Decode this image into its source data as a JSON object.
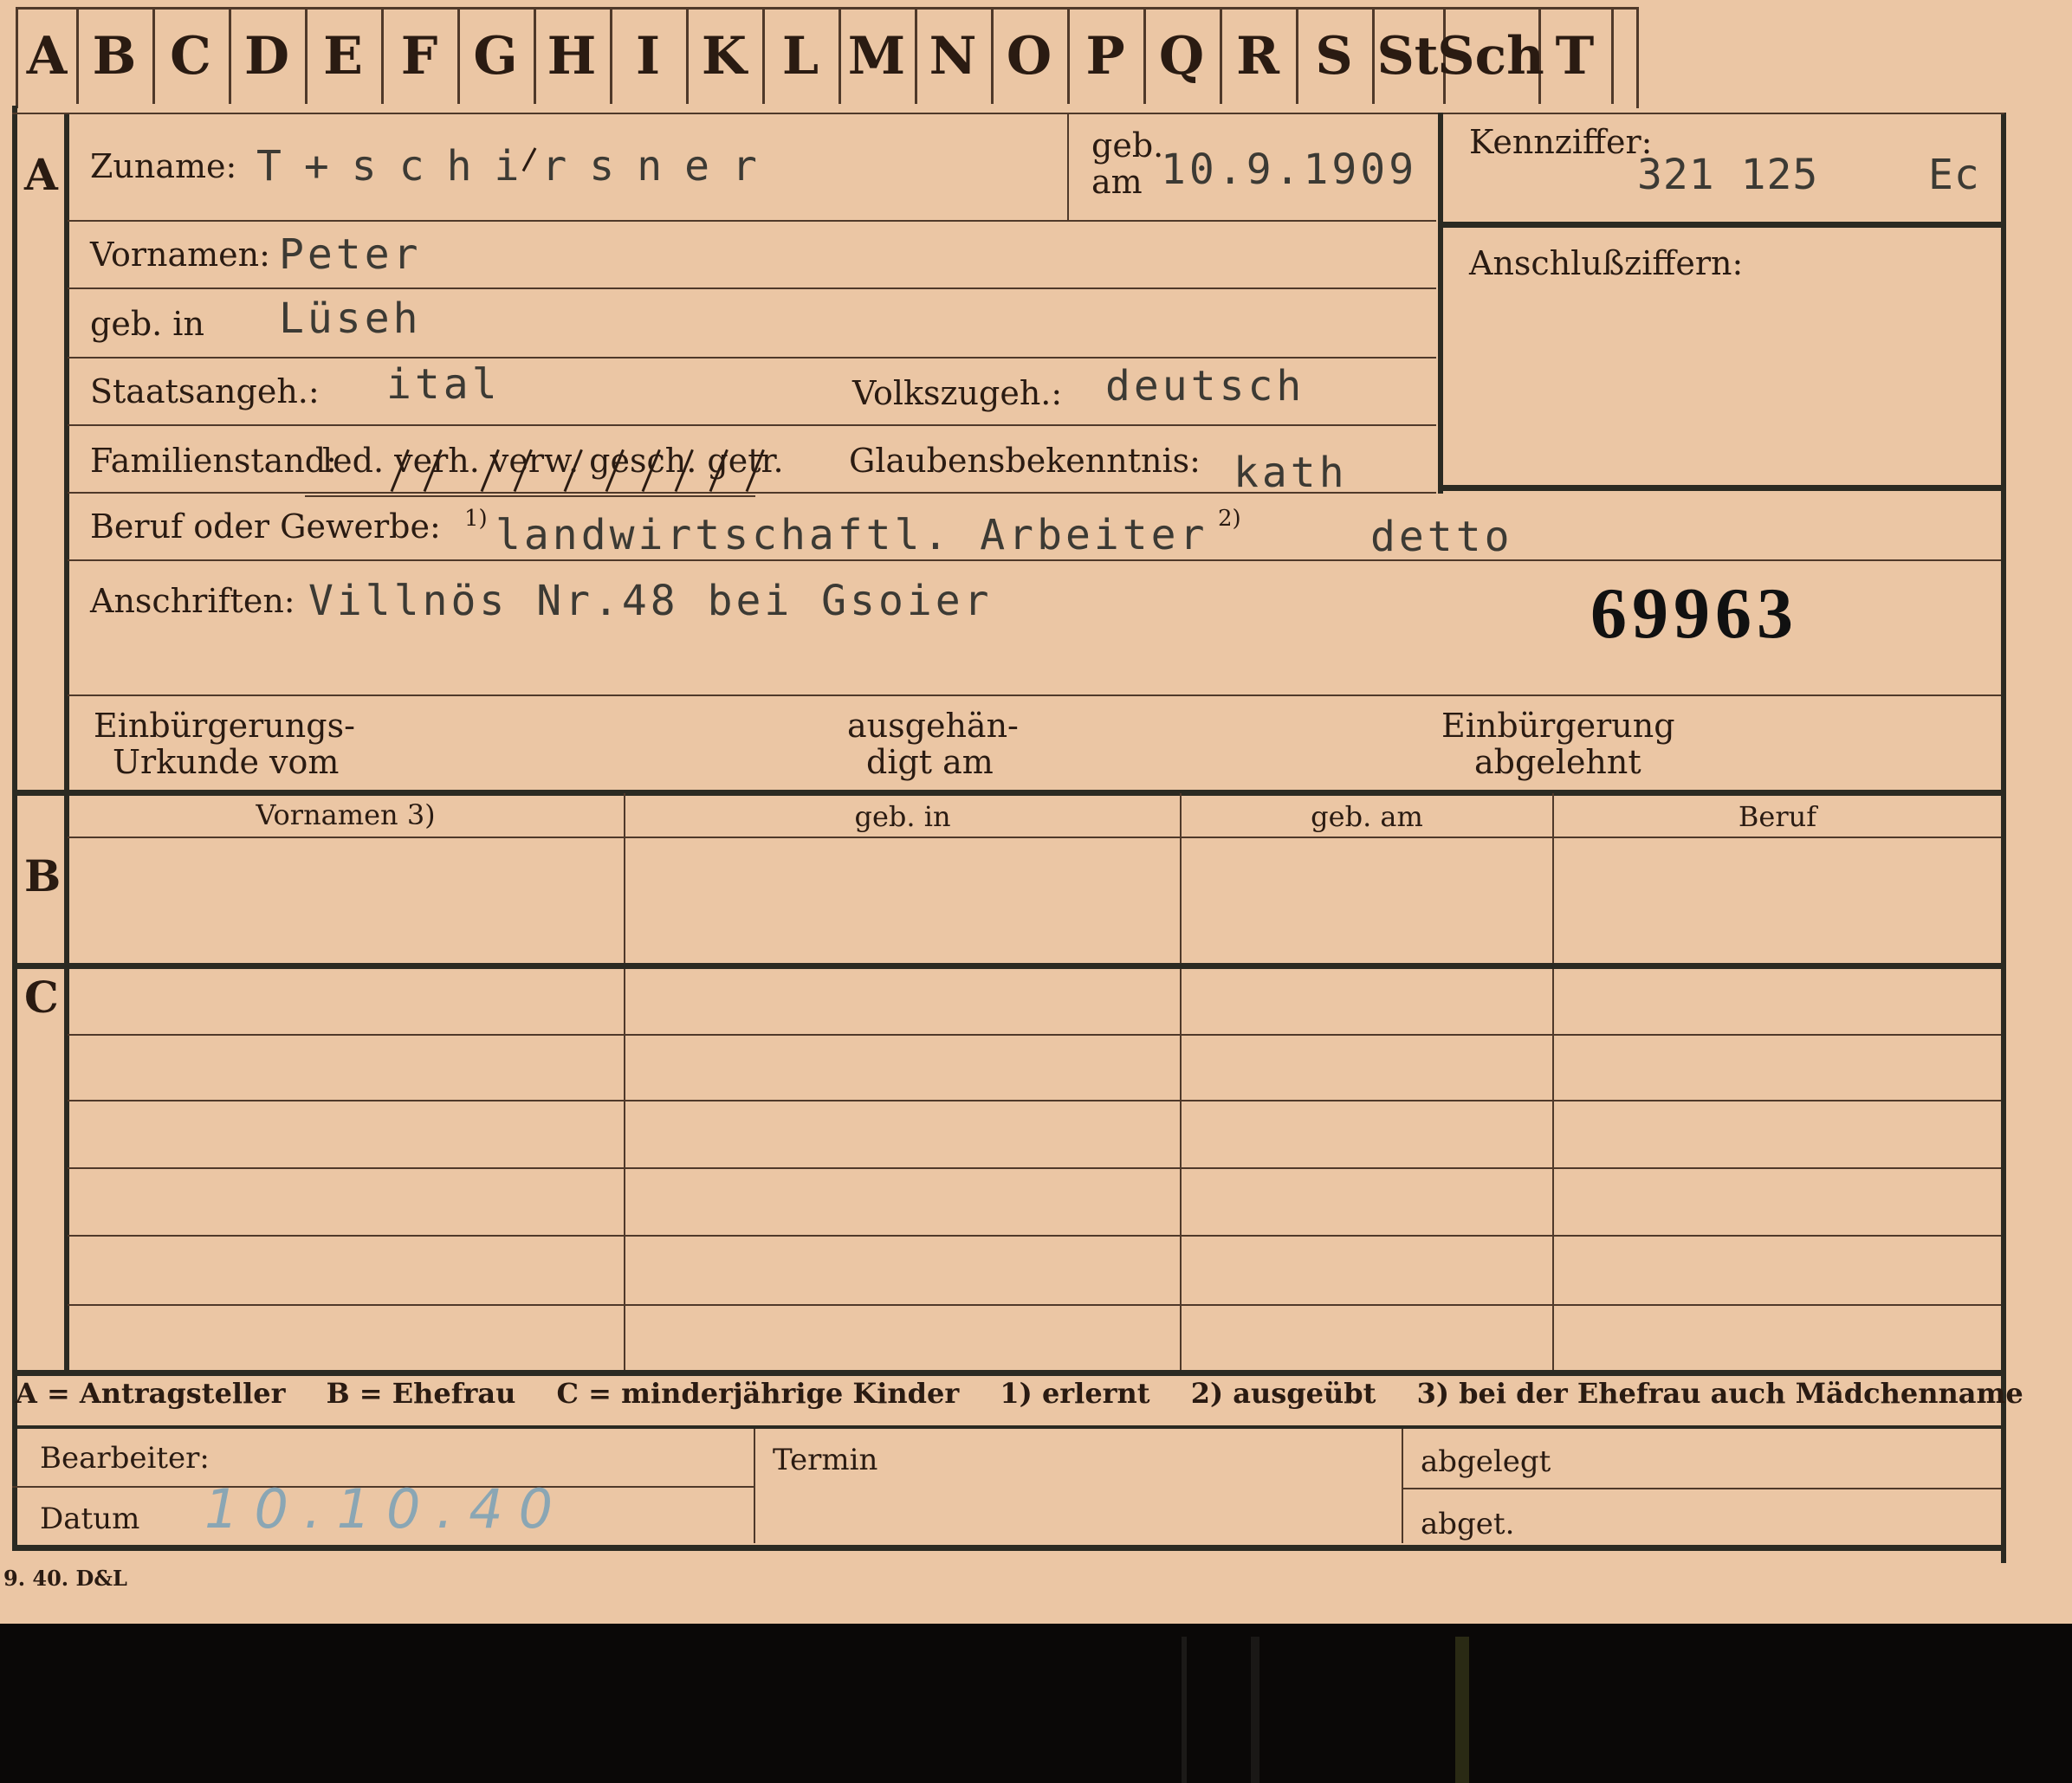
{
  "index_tabs": [
    "A",
    "B",
    "C",
    "D",
    "E",
    "F",
    "G",
    "H",
    "I",
    "K",
    "L",
    "M",
    "N",
    "O",
    "P",
    "Q",
    "R",
    "S",
    "St",
    "Sch",
    "T"
  ],
  "sections": {
    "a": "A",
    "b": "B",
    "c": "C"
  },
  "labels": {
    "zuname": "Zuname:",
    "geb": "geb.",
    "am": "am",
    "kennziffer": "Kennziffer:",
    "anschlussziffern": "Anschlußziffern:",
    "vornamen": "Vornamen:",
    "geb_in": "geb. in",
    "staatsangeh": "Staatsangeh.:",
    "volkszugeh": "Volkszugeh.:",
    "familienstand": "Familienstand:",
    "familienstand_options": "led. verh. verw. gesch. getr.",
    "glaubensbekenntnis": "Glaubensbekenntnis:",
    "beruf": "Beruf oder Gewerbe:",
    "fn1": "1)",
    "fn2": "2)",
    "anschriften": "Anschriften:",
    "einb_urkunde_1": "Einbürgerungs-",
    "einb_urkunde_2": "Urkunde vom",
    "ausgehaendigt_1": "ausgehän-",
    "ausgehaendigt_2": "digt am",
    "einb_abgelehnt_1": "Einbürgerung",
    "einb_abgelehnt_2": "abgelehnt",
    "bearbeiter": "Bearbeiter:",
    "datum": "Datum",
    "termin": "Termin",
    "abgelegt": "abgelegt",
    "abget": "abget."
  },
  "table_headers": [
    "Vornamen 3)",
    "geb. in",
    "geb. am",
    "Beruf"
  ],
  "legend": [
    "A = Antragsteller",
    "B = Ehefrau",
    "C = minderjährige Kinder",
    "1) erlernt",
    "2) ausgeübt",
    "3) bei der Ehefrau auch Mädchenname"
  ],
  "values": {
    "zuname": "T+schirsner",
    "geb_am": "10.9.1909",
    "kennziffer": "321 125",
    "kennziffer_suffix": "Ec",
    "vornamen": "Peter",
    "geb_in": "Lüseh",
    "staatsangeh": "ital",
    "volkszugeh": "deutsch",
    "glaubensbekenntnis": "kath",
    "beruf_erlernt": "landwirtschaftl. Arbeiter",
    "beruf_ausgeuebt": "detto",
    "anschrift": "Villnös Nr.48 bei Gsoier",
    "stamp_number": "69963",
    "datum": "10.10.40"
  },
  "print_mark": "9. 40. D&L"
}
